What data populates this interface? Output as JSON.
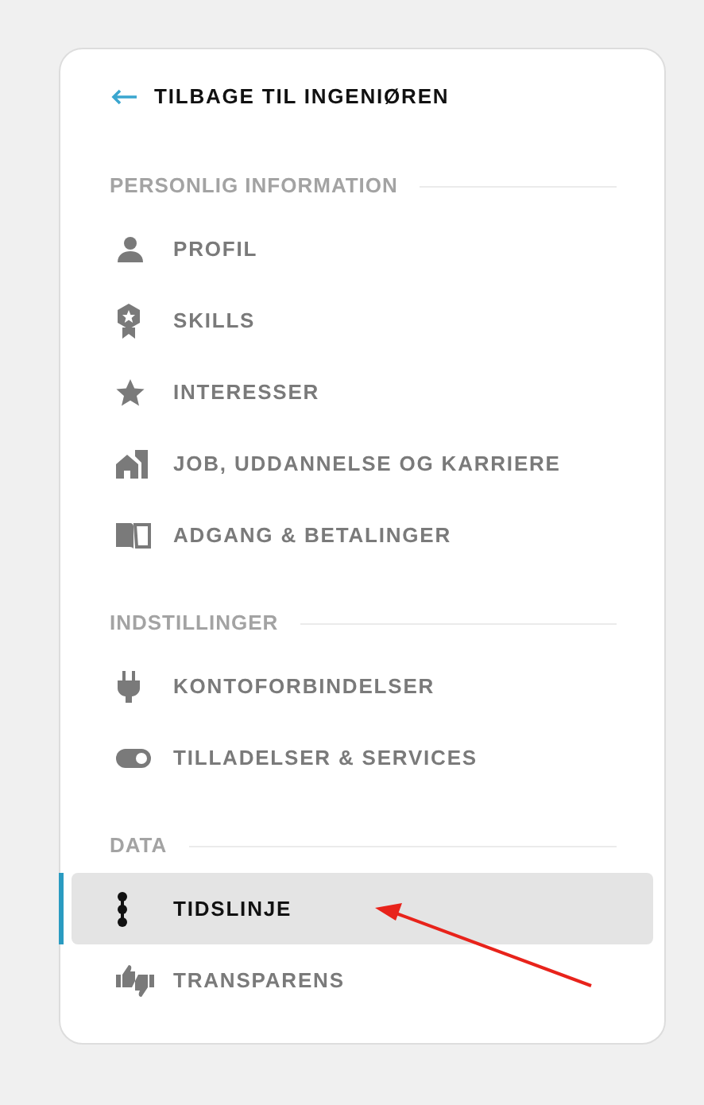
{
  "back_link": {
    "label": "TILBAGE TIL INGENIØREN"
  },
  "sections": [
    {
      "title": "PERSONLIG INFORMATION",
      "items": [
        {
          "label": "PROFIL",
          "selected": false
        },
        {
          "label": "SKILLS",
          "selected": false
        },
        {
          "label": "INTERESSER",
          "selected": false
        },
        {
          "label": "JOB, UDDANNELSE OG KARRIERE",
          "selected": false
        },
        {
          "label": "ADGANG & BETALINGER",
          "selected": false
        }
      ]
    },
    {
      "title": "INDSTILLINGER",
      "items": [
        {
          "label": "KONTOFORBINDELSER",
          "selected": false
        },
        {
          "label": "TILLADELSER & SERVICES",
          "selected": false
        }
      ]
    },
    {
      "title": "DATA",
      "items": [
        {
          "label": "TIDSLINJE",
          "selected": true
        },
        {
          "label": "TRANSPARENS",
          "selected": false
        }
      ]
    }
  ]
}
